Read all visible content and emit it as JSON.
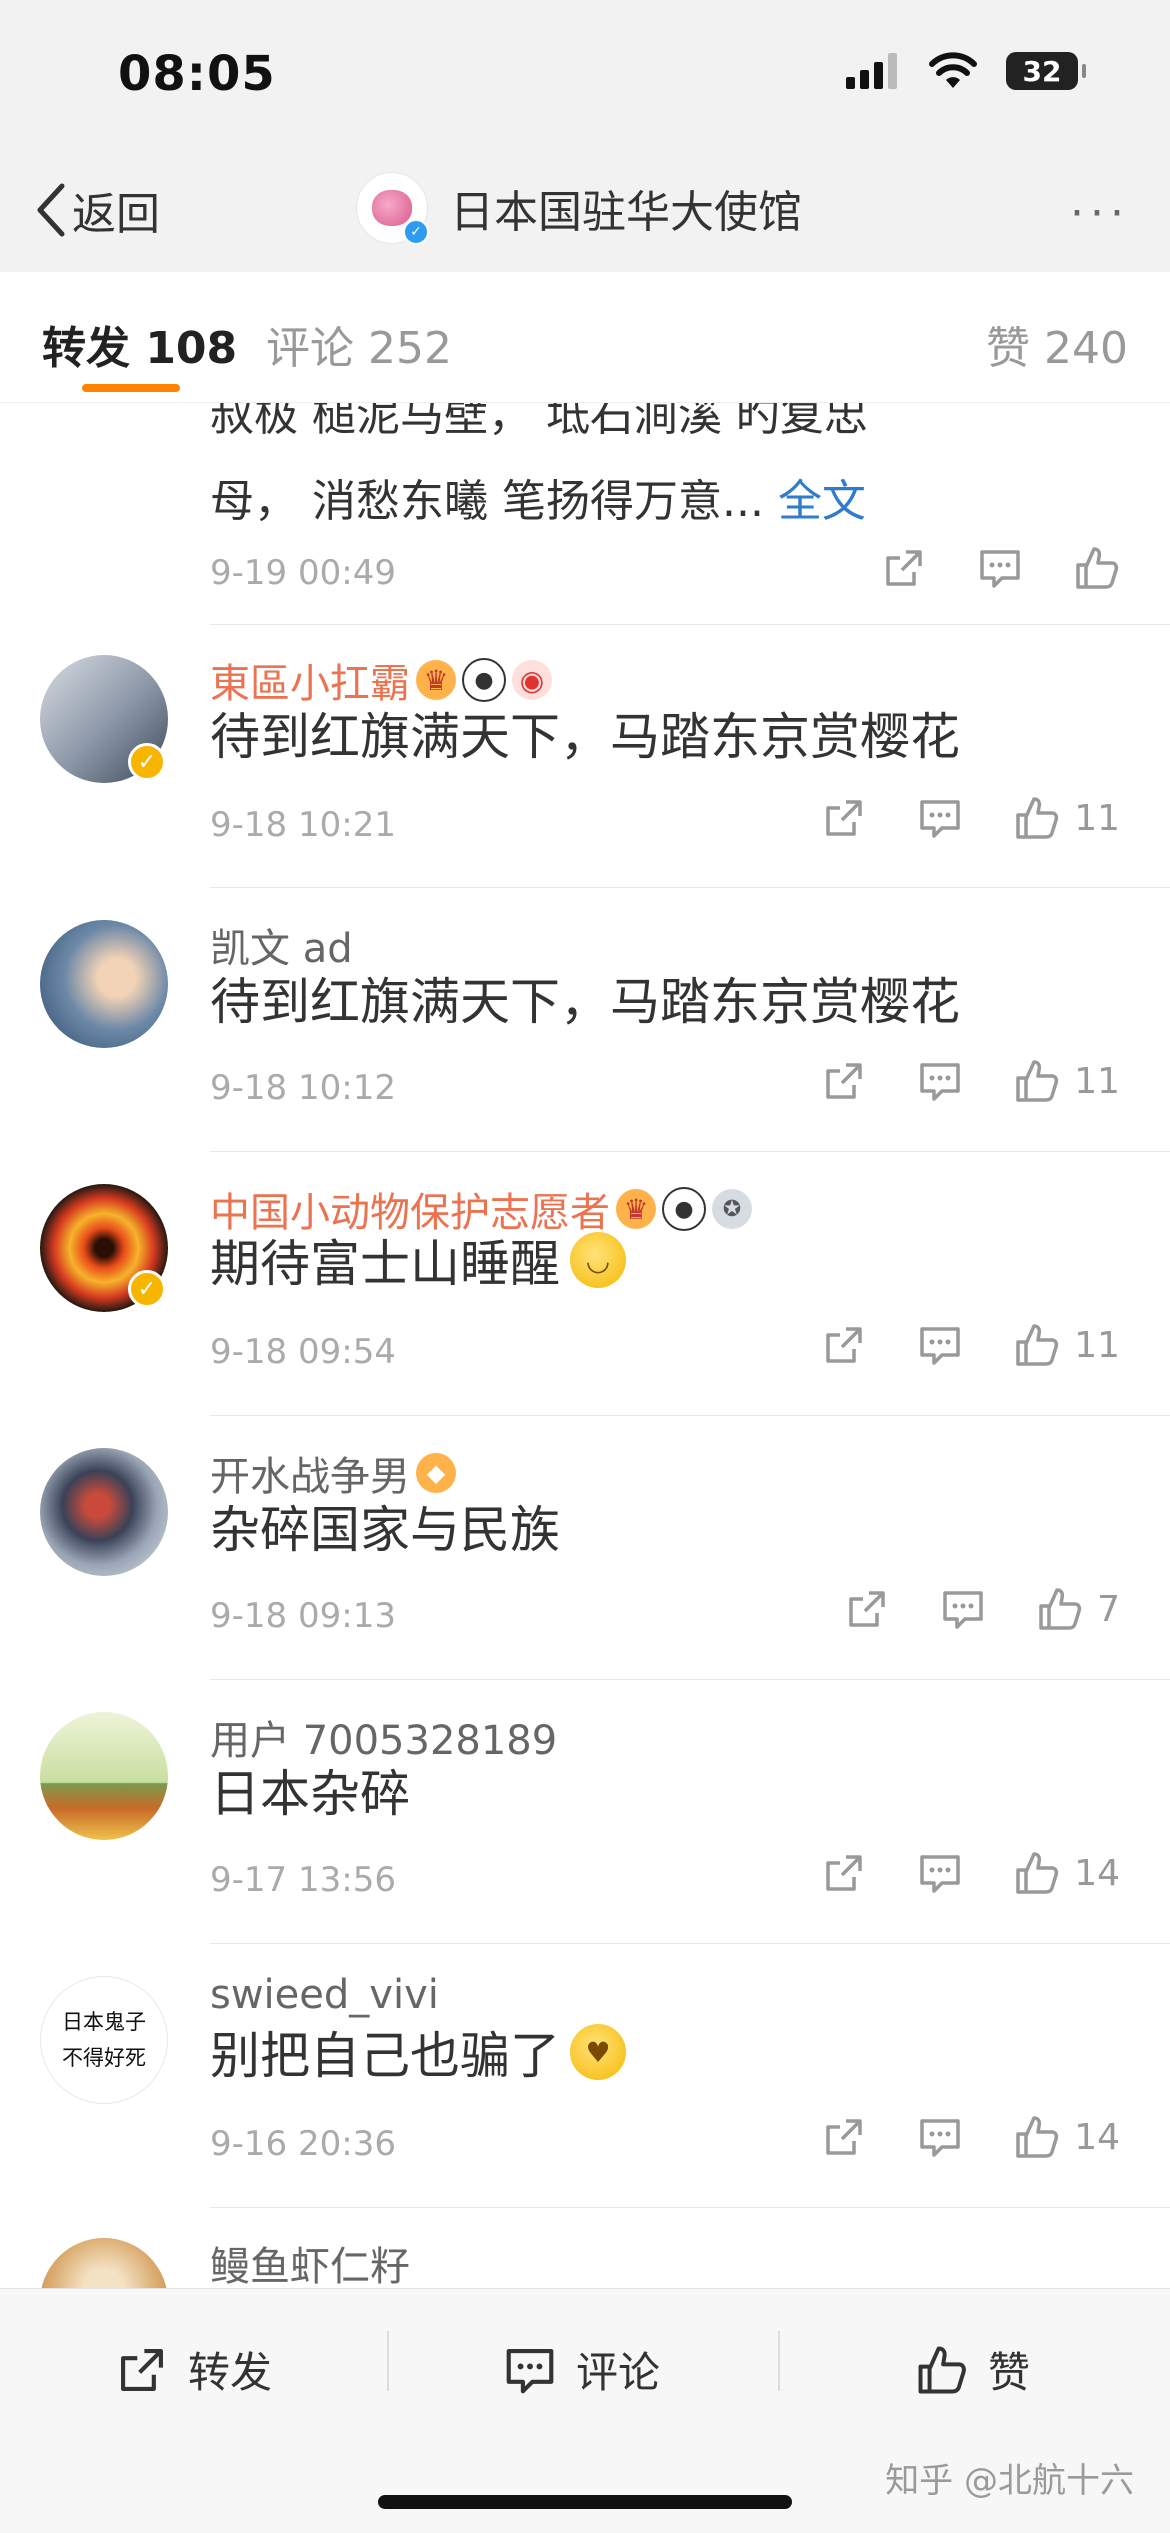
{
  "status_bar": {
    "time": "08:05",
    "battery": "32"
  },
  "nav": {
    "back_label": "返回",
    "title": "日本国驻华大使馆",
    "more": "···"
  },
  "tabs": {
    "repost": "转发 108",
    "comment": "评论 252",
    "like": "赞 240"
  },
  "partial_comment": {
    "line1": "叔极      槌泥马壁，  坻石涧溪      旳复忠",
    "line2": "母，  消愁东曦      笔扬得万意...",
    "full_text_link": "全文",
    "date": "9-19 00:49"
  },
  "comments": [
    {
      "name": "東區小扛霸",
      "text": "待到红旗满天下，马踏东京赏樱花",
      "date": "9-18 10:21",
      "likes": "11"
    },
    {
      "name": "凯文 ad",
      "text": "待到红旗满天下，马踏东京赏樱花",
      "date": "9-18 10:12",
      "likes": "11"
    },
    {
      "name": "中国小动物保护志愿者",
      "text": "期待富士山睡醒",
      "date": "9-18 09:54",
      "likes": "11"
    },
    {
      "name": "开水战争男",
      "text": "杂碎国家与民族",
      "date": "9-18 09:13",
      "likes": "7"
    },
    {
      "name": "用户 7005328189",
      "text": "日本杂碎",
      "date": "9-17 13:56",
      "likes": "14"
    },
    {
      "name": "swieed_vivi",
      "text": "别把自己也骗了",
      "date": "9-16 20:36",
      "likes": "14",
      "avatar_text": [
        "日本鬼子",
        "不得好死"
      ]
    },
    {
      "name": "鳗鱼虾仁籽"
    }
  ],
  "bottom_bar": {
    "repost": "转发",
    "comment": "评论",
    "like": "赞"
  },
  "watermark": "知乎 @北航十六",
  "colors": {
    "accent": "#ff8200",
    "vip_name": "#eb7350",
    "link": "#2e7bcf"
  }
}
